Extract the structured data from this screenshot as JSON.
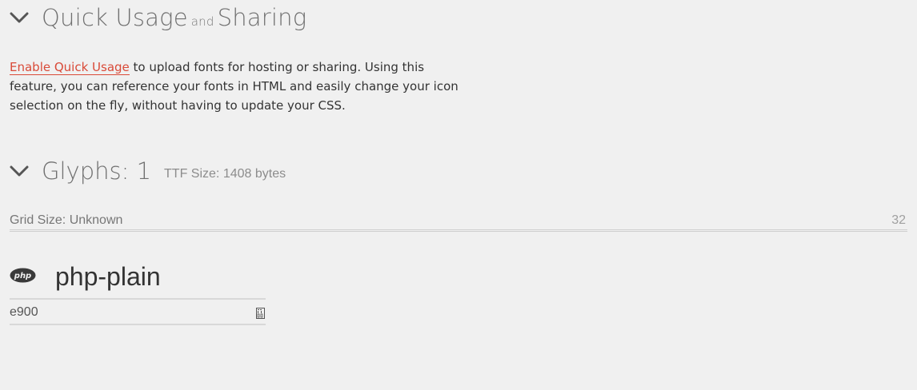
{
  "quick_usage": {
    "title_main": "Quick Usage",
    "title_and": "and",
    "title_end": "Sharing",
    "enable_link": "Enable Quick Usage",
    "description_rest": " to upload fonts for hosting or sharing. Using this feature, you can reference your fonts in HTML and easily change your icon selection on the fly, without having to update your CSS."
  },
  "glyphs": {
    "title": "Glyphs: 1",
    "ttf_size": "TTF Size: 1408 bytes",
    "grid_label": "Grid Size: Unknown",
    "grid_value": "32",
    "items": [
      {
        "icon": "php-icon",
        "icon_text": "php",
        "name": "php-plain",
        "code": "e900"
      }
    ]
  },
  "colors": {
    "background": "#f0f0f0",
    "link": "#d94a38",
    "heading": "#707070"
  }
}
